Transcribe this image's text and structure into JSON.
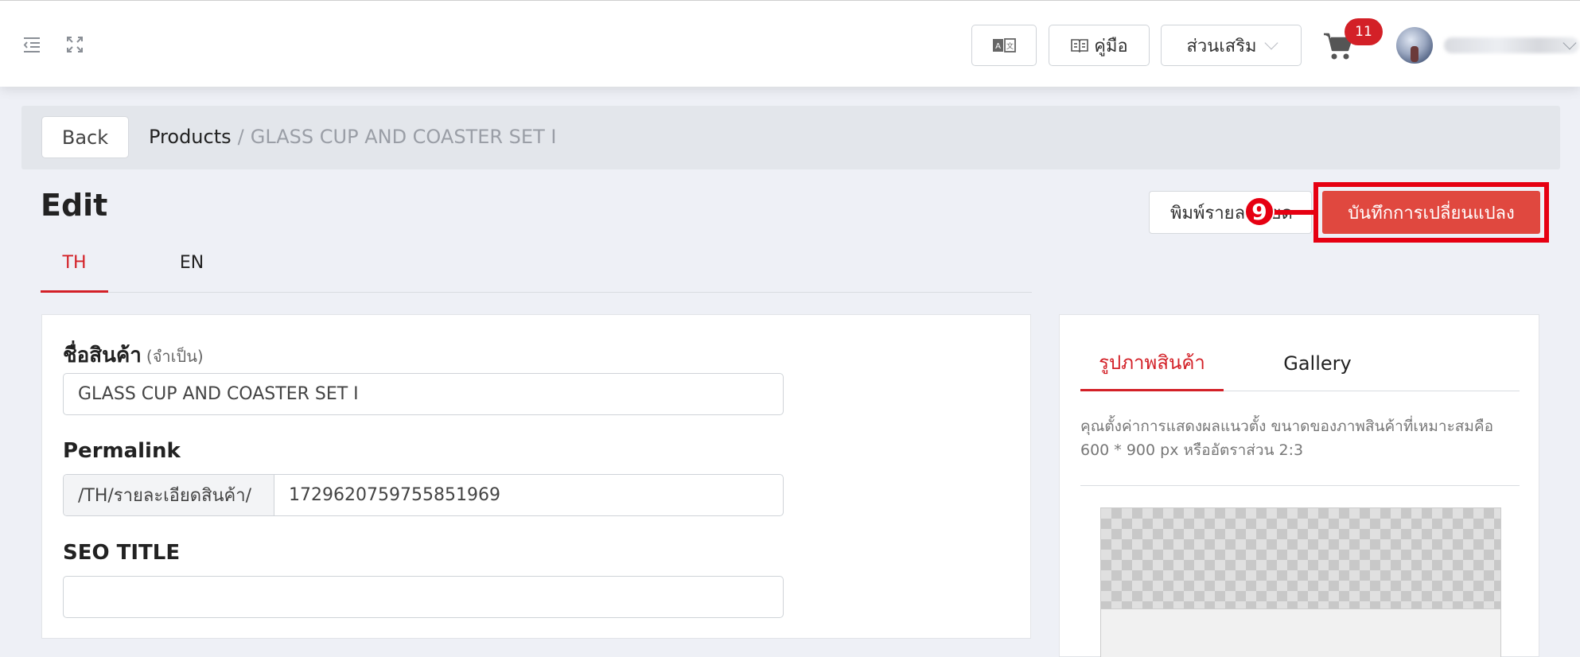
{
  "header": {
    "translate_icon": "translate-icon",
    "manual_label": "คู่มือ",
    "addons_label": "ส่วนเสริม",
    "cart_count": "11"
  },
  "breadcrumb": {
    "back_label": "Back",
    "root": "Products",
    "separator": "/",
    "current": "GLASS CUP AND COASTER SET I"
  },
  "page": {
    "title": "Edit",
    "print_label": "พิมพ์รายละเอียด",
    "save_label": "บันทึกการเปลี่ยนแปลง",
    "step_marker": "9"
  },
  "lang_tabs": [
    {
      "label": "TH",
      "active": true
    },
    {
      "label": "EN",
      "active": false
    }
  ],
  "form": {
    "name_label": "ชื่อสินค้า",
    "name_required": "(จำเป็น)",
    "name_value": "GLASS CUP AND COASTER SET I",
    "permalink_label": "Permalink",
    "permalink_prefix": "/TH/รายละเอียดสินค้า/",
    "permalink_value": "1729620759755851969",
    "seo_title_label": "SEO TITLE",
    "seo_title_value": ""
  },
  "image_panel": {
    "tabs": [
      {
        "label": "รูปภาพสินค้า",
        "active": true
      },
      {
        "label": "Gallery",
        "active": false
      }
    ],
    "hint": "คุณตั้งค่าการแสดงผลแนวตั้ง ขนาดของภาพสินค้าที่เหมาะสมคือ 600 * 900 px หรืออัตราส่วน 2:3"
  },
  "colors": {
    "accent": "#d32027",
    "highlight": "#e60012",
    "save_button": "#e0483f"
  }
}
